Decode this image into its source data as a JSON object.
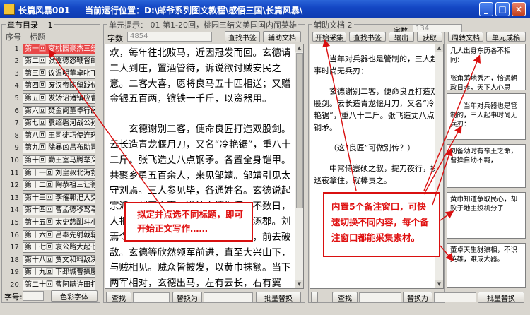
{
  "window": {
    "app_title": "长篇风暴001",
    "location": "当前运行位置：D:\\邮爷系列图文教程\\感悟三国\\长篇风暴\\",
    "minimize": "_",
    "maximize": "□",
    "close": "×"
  },
  "chapters": {
    "group_label": "章节目录",
    "count": "1",
    "header_num": "序号",
    "header_title": "标题",
    "font_label": "字号:",
    "font_button": "色彩字体",
    "items": [
      {
        "num": "1.",
        "title": "第一回 宴桃园豪杰三结义"
      },
      {
        "num": "2.",
        "title": "第二回 张翼德怒鞭督邮"
      },
      {
        "num": "3.",
        "title": "第三回 议温明董卓叱丁原"
      },
      {
        "num": "4.",
        "title": "第四回 废汉帝陈留践位"
      },
      {
        "num": "5.",
        "title": "第五回 发矫诏诸镇应曹公"
      },
      {
        "num": "6.",
        "title": "第六回 焚金阙董卓行凶"
      },
      {
        "num": "7.",
        "title": "第七回 袁绍磐河战公孙"
      },
      {
        "num": "8.",
        "title": "第八回 王司徒巧使连环计"
      },
      {
        "num": "9.",
        "title": "第九回 除暴凶吕布助司徒"
      },
      {
        "num": "10.",
        "title": "第十回 勤王室马腾举义"
      },
      {
        "num": "11.",
        "title": "第十一回 刘皇叔北海救孔融"
      },
      {
        "num": "12.",
        "title": "第十二回 陶恭祖三让徐州"
      },
      {
        "num": "13.",
        "title": "第十三回 李傕郭汜大交兵"
      },
      {
        "num": "14.",
        "title": "第十四回 曹孟德移驾幸许都"
      },
      {
        "num": "15.",
        "title": "第十五回 太史慈酣斗小霸王"
      },
      {
        "num": "16.",
        "title": "第十六回 吕奉先射戟辕门"
      },
      {
        "num": "17.",
        "title": "第十七回 袁公路大起七军"
      },
      {
        "num": "18.",
        "title": "第十八回 贾文和料敌决胜"
      },
      {
        "num": "19.",
        "title": "第十九回 下邳城曹操鏖兵"
      },
      {
        "num": "20.",
        "title": "第二十回 曹阿瞒许田打围"
      }
    ]
  },
  "main": {
    "group_label": "单元提示： 01 第1-20回，桃园三结义美国国内闹英雄",
    "word_label": "字数",
    "word_count": "4854",
    "btn_bookmark": "查找书签",
    "btn_doc": "辅助文档",
    "paragraphs": [
      "欢，每年往北败马，近因冠发而回。玄德请二人到庄，置酒管待，诉说欲讨贼安民之意。二客大喜，愿将良马五十匹相送；又赠金银五百两，镔铁一千斤，以资器用。",
      "玄德谢别二客，便命良匠打造双股剑。云长造青龙偃月刀，又名“冷艳锯”，重八十二斤。张飞造丈八点钢矛。各置全身铠甲。共聚乡勇五百余人，来见邹靖。邹靖引见太守刘焉。三人参见毕，各通姓名。玄德说起宗派，刘焉大喜，遂认玄德为侄。不数日，人报黄巾贼将程远志统兵五万来犯涿郡。刘焉令邹靖引玄德等三人，统兵五百，前去破敌。玄德等欣然领军前进，直至大兴山下，与贼相见。贼众皆披发，以黄巾抹额。当下两军相对，玄德出马，左有云长，右有翼德，扬鞭大骂：“反国逆贼，何不早降！”程远"
    ],
    "btn_find": "查找",
    "btn_replace": "替换为",
    "btn_batch": "批量替换"
  },
  "aux": {
    "group_label": "辅助文档 2",
    "word_label": "字数",
    "word_count": "134",
    "btn_collect": "开始采集",
    "btn_bookmark": "查找书签",
    "btn_output": "输出",
    "btn_fetch": "获取",
    "btn_weekly": "周转文档",
    "btn_finish": "单元成稿",
    "paragraphs": [
      "当年对兵器也是管制的，三人起事时尚无兵刃：",
      "玄德谢别二客，便命良匠打造双股剑。云长造青龙偃月刀，又名“冷艳锯”，重八十二斤。张飞造丈八点钢矛。",
      "（这“良匠”可做别传？）",
      "中常侍蹇硕之叔，提刀夜行，操巡夜拿住，就棒责之。"
    ],
    "btn_find": "查找",
    "btn_replace": "替换为",
    "btn_batch": "批量替换"
  },
  "notes": [
    "几人出身东历各不相同：\n\n张角落地秀才，恰遇朝政日非，天下人心思",
    "当年对兵器也是管制的，三人起事时尚无兵刃：",
    "刘备幼时有帝王之命，曹操自幼不羁，",
    "黄巾知道争取民心，却败于地主投机分子",
    "董卓天生豺狼相，不识英雄，难成大器。"
  ],
  "callouts": {
    "left": "拟定并点选不同标题，即可开始正文写作……",
    "right": "内置5个备注窗口，可快速切换不同内容，每个备注窗口都能采集素材。"
  },
  "colors": {
    "callout_red": "#e01010",
    "active_chapter": "#e84848",
    "titlebar_blue": "#1447c4"
  }
}
